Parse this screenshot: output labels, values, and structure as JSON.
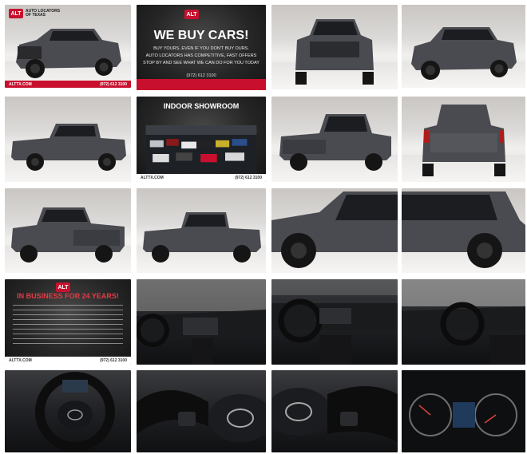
{
  "gallery": {
    "brand": {
      "name_line1": "AUTO LOCATORS",
      "name_line2": "OF TEXAS",
      "badge": "ALT",
      "site": "ALTTX.COM",
      "phone": "(972) 612 3100"
    },
    "promo_buy": {
      "headline": "WE BUY CARS!",
      "line1": "BUY YOURS, EVEN IF YOU DON'T BUY OURS.",
      "line2": "AUTO LOCATORS HAS COMPETITIVE, FAST OFFERS",
      "line3": "STOP BY AND SEE WHAT WE CAN DO FOR YOU TODAY"
    },
    "promo_showroom": {
      "headline": "INDOOR SHOWROOM"
    },
    "promo_years": {
      "headline": "IN BUSINESS FOR 24 YEARS!"
    },
    "colors": {
      "accent_red": "#c8102e",
      "truck_gray": "#4a4b50"
    }
  }
}
